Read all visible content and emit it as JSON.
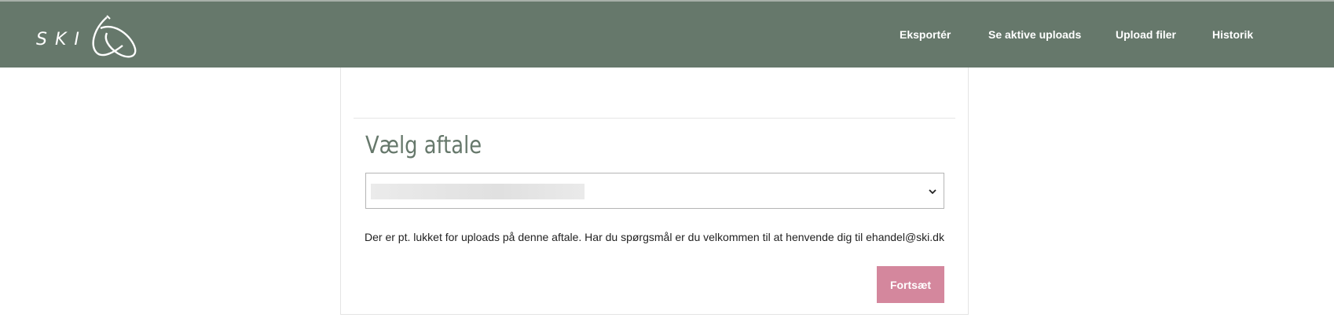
{
  "header": {
    "logo_text": "SKI",
    "nav": [
      {
        "label": "Eksportér"
      },
      {
        "label": "Se aktive uploads"
      },
      {
        "label": "Upload filer"
      },
      {
        "label": "Historik"
      }
    ],
    "colors": {
      "bar": "#66786b",
      "text": "#ffffff"
    }
  },
  "main": {
    "title": "Vælg aftale",
    "select": {
      "selected_value": "",
      "value_redacted": true
    },
    "notice": "Der er pt. lukket for uploads på denne aftale. Har du spørgsmål er du velkommen til at henvende dig til ehandel@ski.dk",
    "continue_label": "Fortsæt",
    "colors": {
      "title": "#66786b",
      "button": "#d4879d"
    }
  }
}
